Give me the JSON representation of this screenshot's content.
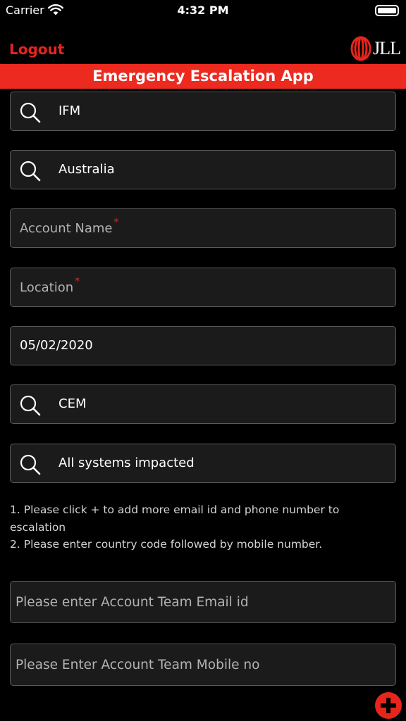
{
  "status_bar": {
    "carrier": "Carrier",
    "time": "4:32 PM",
    "wifi_icon": "wifi-icon",
    "battery_icon": "battery-icon"
  },
  "header": {
    "logout_label": "Logout",
    "logo_text": "JLL",
    "title": "Emergency Escalation App"
  },
  "fields": {
    "business_line": "IFM",
    "country": "Australia",
    "account_name_placeholder": "Account Name",
    "location_placeholder": "Location",
    "required_mark": "*",
    "date": "05/02/2020",
    "category": "CEM",
    "impact": "All systems impacted"
  },
  "instructions": [
    "1. Please click + to add more email id and phone number to escalation",
    "2. Please enter country code followed by mobile number."
  ],
  "contacts": {
    "email_placeholder": "Please enter Account Team Email id",
    "mobile_placeholder": "Please Enter Account Team Mobile no"
  },
  "colors": {
    "accent": "#ec2a1f",
    "field_bg": "#1b1b1b",
    "field_border": "#5a5a5a",
    "background": "#000000"
  }
}
